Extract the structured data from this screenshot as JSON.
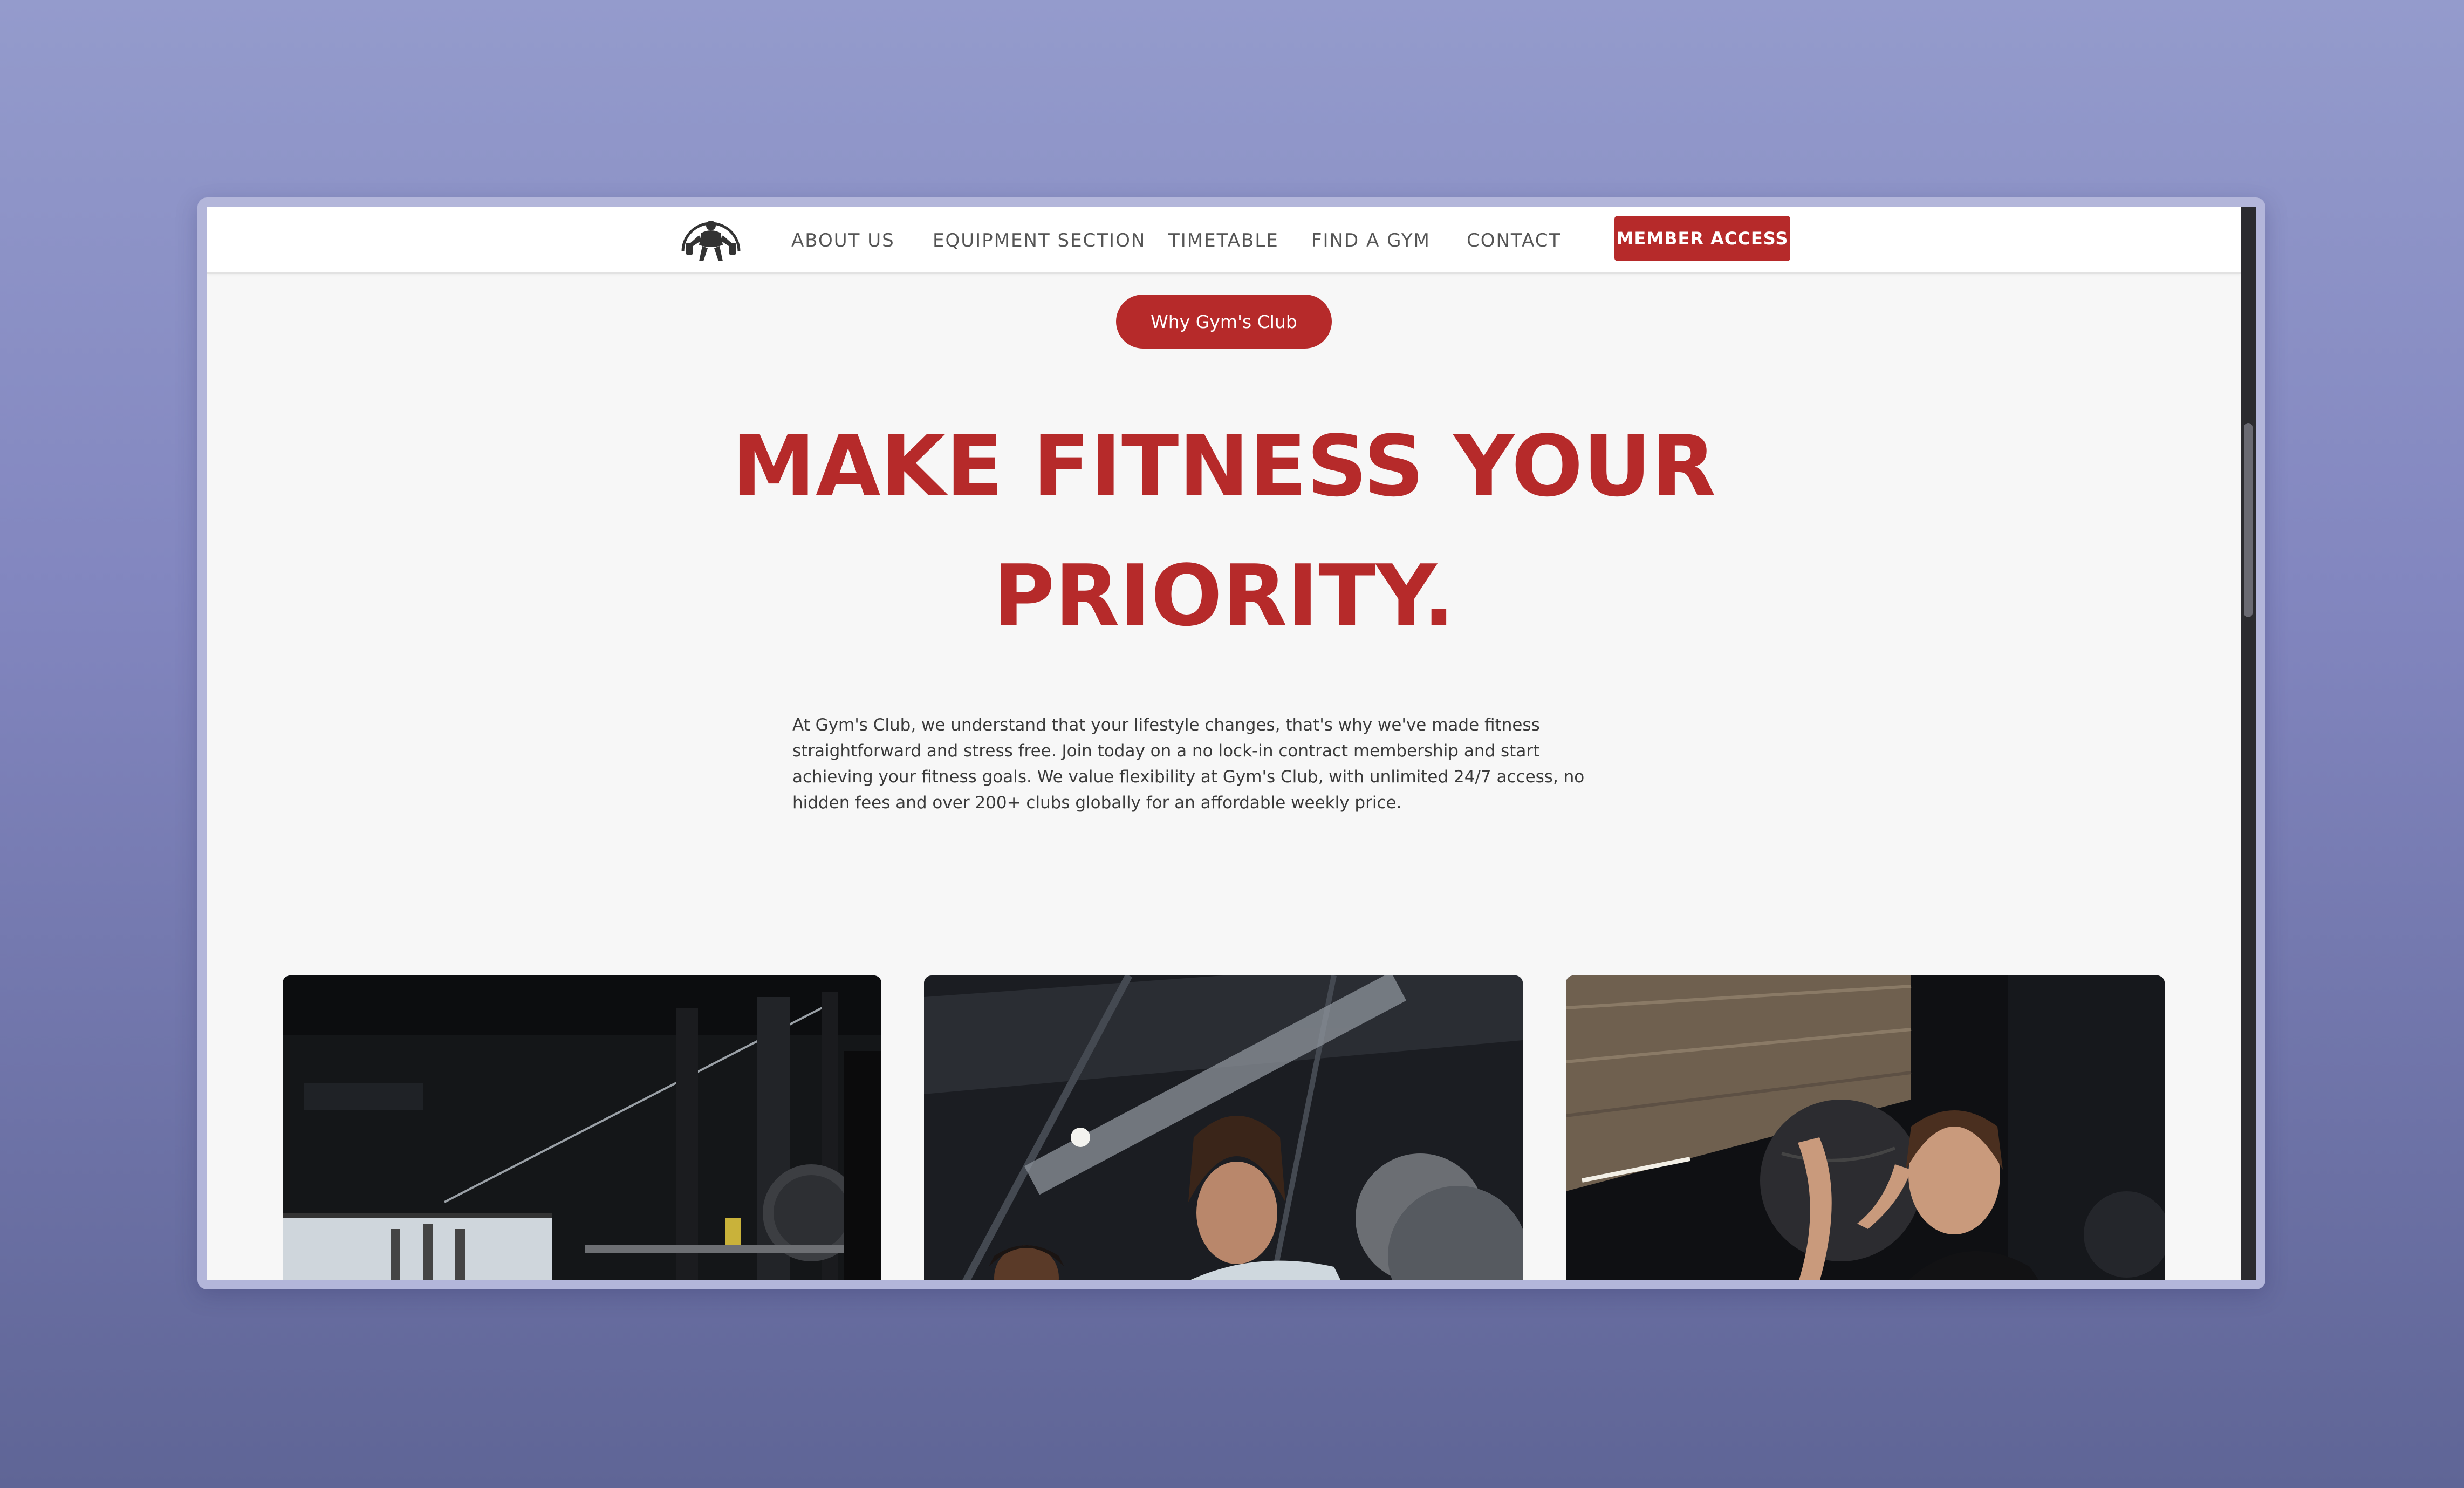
{
  "nav": {
    "logo_alt": "gym-logo",
    "links": [
      {
        "label": "ABOUT US"
      },
      {
        "label": "EQUIPMENT SECTION"
      },
      {
        "label": "TIMETABLE"
      },
      {
        "label": "FIND A GYM"
      },
      {
        "label": "CONTACT"
      }
    ],
    "member_button": "MEMBER ACCESS"
  },
  "hero": {
    "pill_label": "Why Gym's Club",
    "headline_line1": "MAKE FITNESS YOUR",
    "headline_line2": "PRIORITY.",
    "intro": "At Gym's Club, we understand that your lifestyle changes, that's why we've made fitness straightforward and stress free. Join today on a no lock-in contract membership and start achieving your fitness goals. We value flexibility at Gym's Club, with unlimited 24/7 access, no hidden fees and over 200+ clubs globally for an affordable weekly price."
  },
  "gallery": {
    "images": [
      {
        "subject": "gym-equipment-rack-photo"
      },
      {
        "subject": "woman-training-photo"
      },
      {
        "subject": "woman-medicine-ball-photo"
      }
    ]
  },
  "colors": {
    "brand_red": "#b62a2a",
    "page_bg": "#f7f7f7",
    "nav_text": "#555555"
  }
}
